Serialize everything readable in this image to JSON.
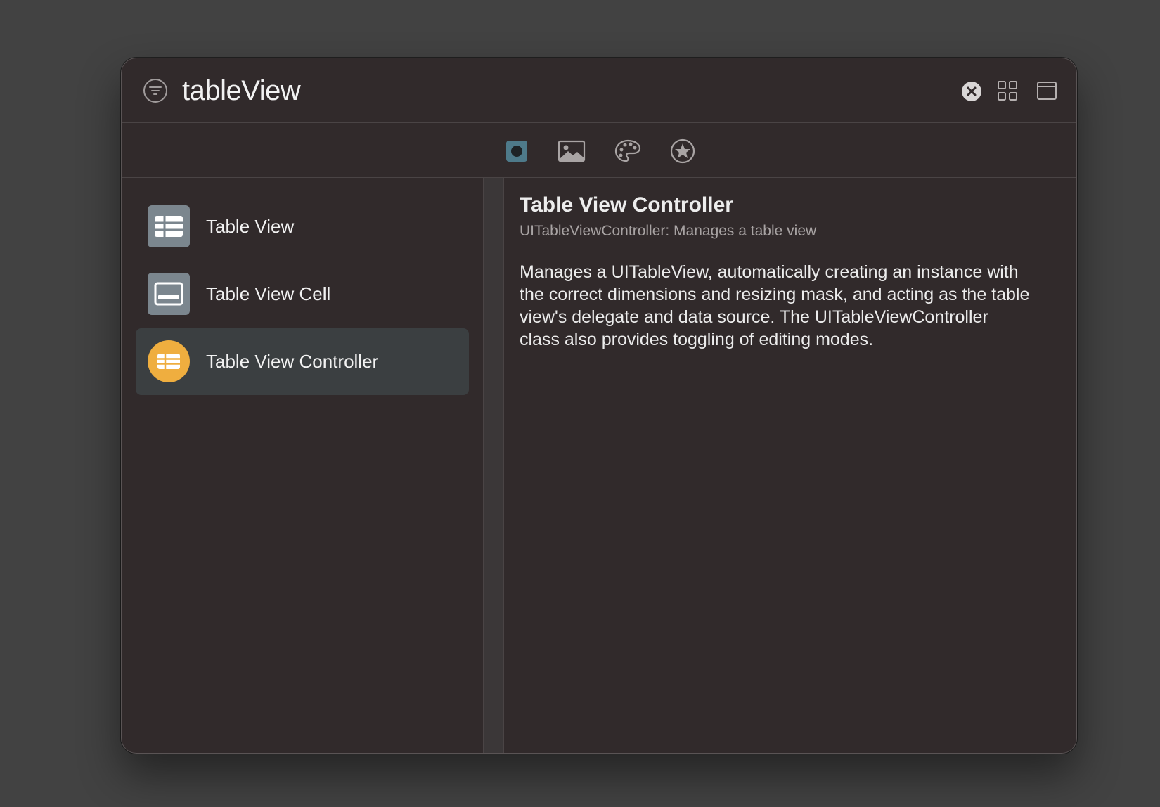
{
  "search": {
    "value": "tableView"
  },
  "toolbar": {
    "tabs": [
      {
        "icon": "objects-icon",
        "selected": true
      },
      {
        "icon": "image-icon",
        "selected": false
      },
      {
        "icon": "palette-icon",
        "selected": false
      },
      {
        "icon": "star-icon",
        "selected": false
      }
    ]
  },
  "list": {
    "items": [
      {
        "label": "Table View",
        "icon": "table-view-icon",
        "selected": false
      },
      {
        "label": "Table View Cell",
        "icon": "table-view-cell-icon",
        "selected": false
      },
      {
        "label": "Table View Controller",
        "icon": "table-view-controller-icon",
        "selected": true
      }
    ]
  },
  "detail": {
    "title": "Table View Controller",
    "subtitle": "UITableViewController: Manages a table view",
    "description": "Manages a UITableView, automatically creating an instance with the correct dimensions and resizing mask, and acting as the table view's delegate and data source.  The UITableViewController class also provides toggling of editing modes."
  },
  "colors": {
    "window_bg": "#312a2b",
    "desktop_bg": "#424242",
    "selected_row": "#3b3f41",
    "accent_tab": "#4e7a8a",
    "controller_icon": "#efae3f",
    "view_icon": "#7b868e"
  }
}
